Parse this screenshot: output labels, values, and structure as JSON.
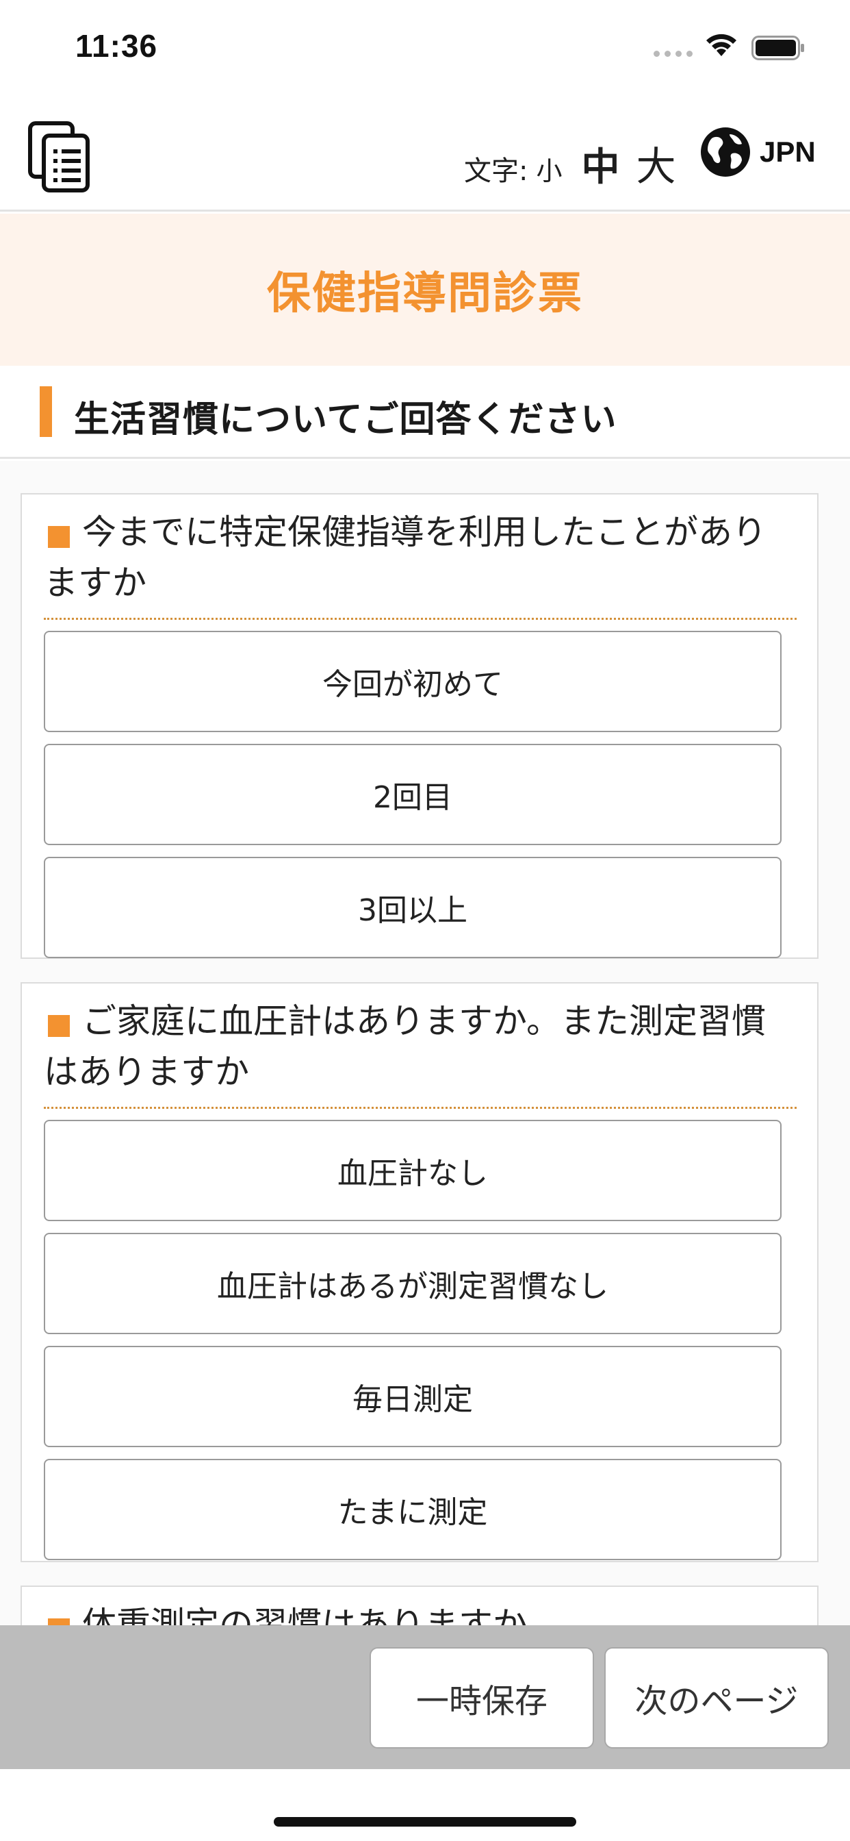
{
  "status_bar": {
    "time": "11:36"
  },
  "header": {
    "menu_icon": "document-list-icon",
    "font_size_label": "文字:",
    "font_size_small": "小",
    "font_size_medium": "中",
    "font_size_large": "大",
    "language_icon": "globe-icon",
    "language_label": "JPN"
  },
  "page_title": "保健指導問診票",
  "section_heading": "生活習慣についてご回答ください",
  "questions": [
    {
      "text": "今までに特定保健指導を利用したことがありますか",
      "options": [
        "今回が初めて",
        "2回目",
        "3回以上"
      ]
    },
    {
      "text": "ご家庭に血圧計はありますか。また測定習慣はありますか",
      "options": [
        "血圧計なし",
        "血圧計はあるが測定習慣なし",
        "毎日測定",
        "たまに測定"
      ]
    },
    {
      "text": "体重測定の習慣はありますか",
      "options": []
    }
  ],
  "footer": {
    "save_label": "一時保存",
    "next_label": "次のページ"
  },
  "colors": {
    "accent": "#f39230",
    "banner_bg": "#fef3eb",
    "footer_bg": "#bcbcbc"
  }
}
